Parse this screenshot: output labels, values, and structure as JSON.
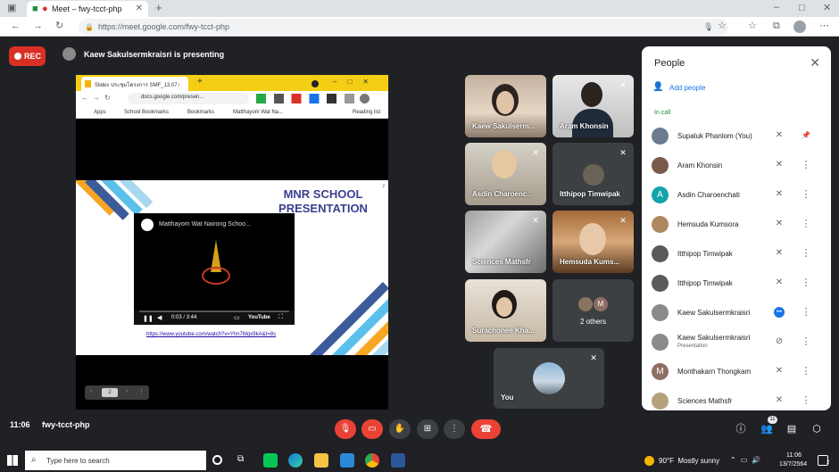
{
  "browser": {
    "tab_title": "Meet – fwy-tcct-php",
    "url": "https://meet.google.com/fwy-tcct-php"
  },
  "meet": {
    "rec_label": "REC",
    "presenting_text": "Kaew Sakulsermkraisri is presenting"
  },
  "shared_screen": {
    "tab_title": "Slides ประชุมโครงการ SMF_13.07.6",
    "address": "docs.google.com/presen...",
    "bookmarks": [
      "Apps",
      "School Bookmarks",
      "Bookmarks",
      "Matthayom Wat Na..."
    ],
    "reading_list": "Reading list",
    "slide_title": "MNR SCHOOL PRESENTATION",
    "slide_number": "2",
    "video_title": "Matthayom Wat Nairong Schoo...",
    "video_time": "0:03 / 3:44",
    "video_brand": "YouTube",
    "video_link": "https://www.youtube.com/watch?v=Yhn7Mqx9kA&t=8s",
    "page_num": "2"
  },
  "tiles": [
    {
      "name": "Kaew Sakulserm..."
    },
    {
      "name": "Aram Khonsin"
    },
    {
      "name": "Asdin Charoenc..."
    },
    {
      "name": "Itthipop Timwipak"
    },
    {
      "name": "Sciences Mathsfr"
    },
    {
      "name": "Hemsuda Kums..."
    },
    {
      "name": "Surachonee Kha..."
    },
    {
      "name": "2 others",
      "initial": "M"
    },
    {
      "name": "You"
    }
  ],
  "people_panel": {
    "title": "People",
    "add_people": "Add people",
    "in_call": "In call",
    "people": [
      {
        "name": "Supaluk Phanlom (You)",
        "initial": "",
        "color": "#6b7c8f"
      },
      {
        "name": "Aram Khonsin",
        "initial": "",
        "color": "#7a5a4a"
      },
      {
        "name": "Asdin Charoenchati",
        "initial": "A",
        "color": "#12a4a8"
      },
      {
        "name": "Hemsuda Kumsora",
        "initial": "",
        "color": "#b08860"
      },
      {
        "name": "Itthipop Timwipak",
        "initial": "",
        "color": "#5a5a5a"
      },
      {
        "name": "Itthipop Timwipak",
        "initial": "",
        "color": "#5a5a5a"
      },
      {
        "name": "Kaew Sakulsermkraisri",
        "initial": "",
        "color": "#8a8a8a"
      },
      {
        "name": "Kaew Sakulsermkraisri",
        "sub": "Presentation",
        "initial": "",
        "color": "#8a8a8a"
      },
      {
        "name": "Monthakarn Thongkam",
        "initial": "M",
        "color": "#8d6e63"
      },
      {
        "name": "Sciences Mathsfr",
        "initial": "",
        "color": "#b5a27a"
      }
    ]
  },
  "bottom_bar": {
    "time": "11:06",
    "meeting_code": "fwy-tcct-php",
    "participant_count": "11"
  },
  "taskbar": {
    "search_placeholder": "Type here to search",
    "weather": "90°F  Mostly sunny",
    "clock_time": "11:06",
    "clock_date": "13/7/2564",
    "notification_count": "2"
  }
}
